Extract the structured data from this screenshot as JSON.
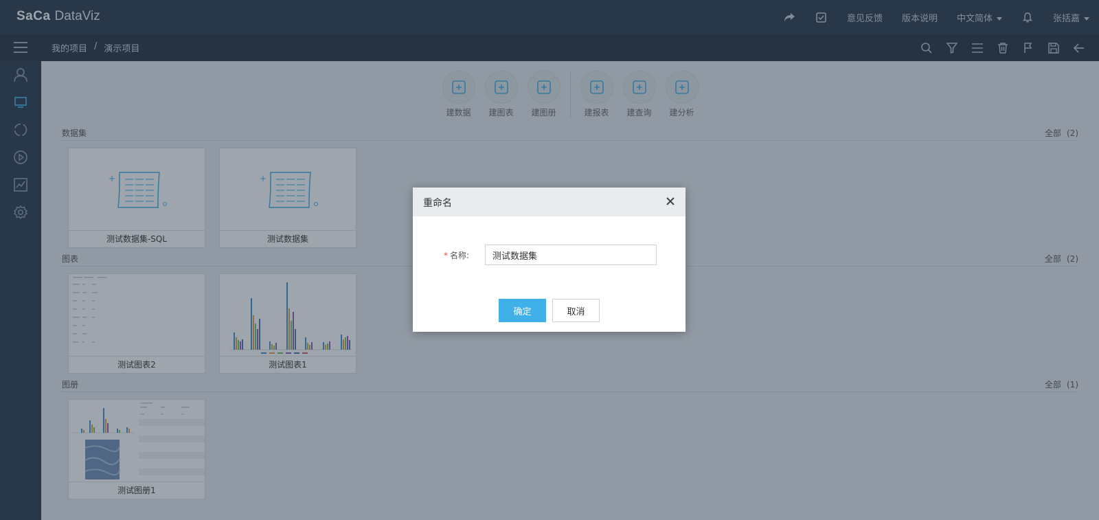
{
  "header": {
    "logo_brand": "SaCa",
    "logo_product": "DataViz",
    "feedback": "意见反馈",
    "version_notes": "版本说明",
    "language": "中文简体",
    "user": "张括嘉"
  },
  "breadcrumb": {
    "root": "我的项目",
    "separator": "/",
    "current": "演示项目"
  },
  "toolbar": {
    "group1": [
      {
        "label": "建数据",
        "icon": "new-data-icon"
      },
      {
        "label": "建图表",
        "icon": "new-chart-icon"
      },
      {
        "label": "建图册",
        "icon": "new-album-icon"
      }
    ],
    "group2": [
      {
        "label": "建报表",
        "icon": "new-report-icon"
      },
      {
        "label": "建查询",
        "icon": "new-query-icon"
      },
      {
        "label": "建分析",
        "icon": "new-analysis-icon"
      }
    ]
  },
  "sections": {
    "datasets": {
      "title": "数据集",
      "all": "全部",
      "count": "(2)",
      "items": [
        "测试数据集-SQL",
        "测试数据集"
      ]
    },
    "charts": {
      "title": "图表",
      "all": "全部",
      "count": "(2)",
      "items": [
        "测试图表2",
        "测试图表1"
      ]
    },
    "albums": {
      "title": "图册",
      "all": "全部",
      "count": "(1)",
      "items": [
        "测试图册1"
      ]
    }
  },
  "dialog": {
    "title": "重命名",
    "required_mark": "*",
    "name_label": "名称:",
    "name_value": "测试数据集",
    "confirm": "确定",
    "cancel": "取消"
  },
  "colors": {
    "header_bg": "#2b3a4c",
    "subbar_bg": "#24313f",
    "accent": "#3fb0e8",
    "required": "#e24c4c"
  }
}
